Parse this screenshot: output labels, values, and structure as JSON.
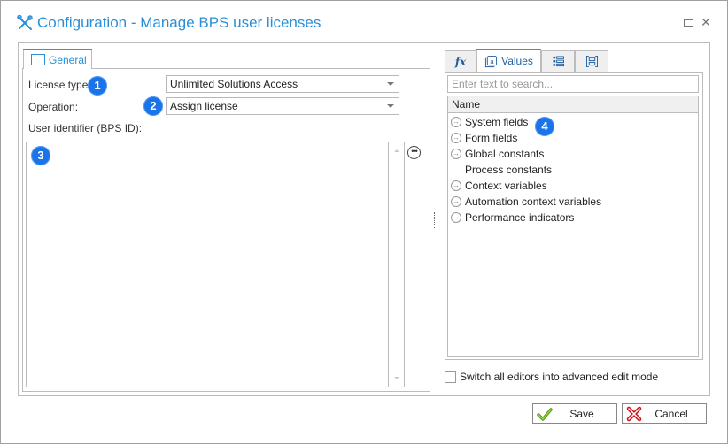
{
  "window": {
    "title": "Configuration - Manage BPS user licenses",
    "maximize_icon": "maximize-icon",
    "close_icon": "close-icon"
  },
  "left": {
    "tab_label": "General",
    "license_type_label": "License type:",
    "license_type_value": "Unlimited Solutions Access",
    "operation_label": "Operation:",
    "operation_value": "Assign license",
    "user_identifier_label": "User identifier (BPS ID):",
    "user_identifier_value": "",
    "more_button_label": "•••"
  },
  "badges": [
    "1",
    "2",
    "3",
    "4"
  ],
  "right": {
    "tabs": [
      {
        "label": "fx",
        "icon": "function-icon"
      },
      {
        "label": "Values",
        "icon": "values-icon"
      },
      {
        "label": "",
        "icon": "list-icon"
      },
      {
        "label": "",
        "icon": "form-icon"
      }
    ],
    "search_placeholder": "Enter text to search...",
    "list_header": "Name",
    "items": [
      {
        "label": "System fields",
        "expandable": true
      },
      {
        "label": "Form fields",
        "expandable": true
      },
      {
        "label": "Global constants",
        "expandable": true
      },
      {
        "label": "Process constants",
        "expandable": false
      },
      {
        "label": "Context variables",
        "expandable": true
      },
      {
        "label": "Automation context variables",
        "expandable": true
      },
      {
        "label": "Performance indicators",
        "expandable": true
      }
    ],
    "advanced_mode_label": "Switch all editors into advanced edit mode",
    "advanced_mode_checked": false
  },
  "footer": {
    "save_label": "Save",
    "cancel_label": "Cancel"
  },
  "colors": {
    "accent": "#1e9be0",
    "title": "#2a8fd6",
    "badge": "#1a73e8",
    "save_icon": "#5a9e1a",
    "cancel_icon": "#d0161b"
  }
}
